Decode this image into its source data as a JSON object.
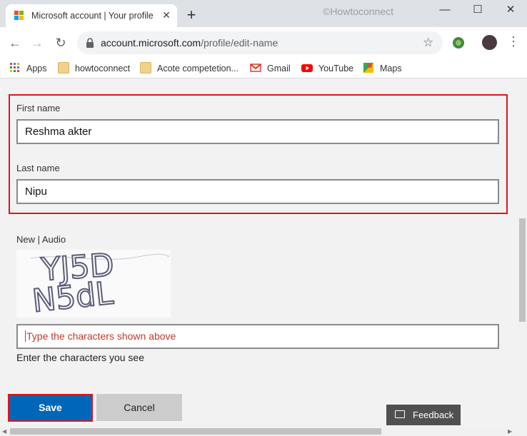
{
  "browser": {
    "tab_title": "Microsoft account | Your profile |",
    "tab_close": "✕",
    "new_tab": "+",
    "watermark": "©Howtoconnect",
    "minimize": "—",
    "maximize": "☐",
    "close": "✕",
    "back_icon": "←",
    "forward_icon": "→",
    "reload_icon": "↻",
    "url_host": "account.microsoft.com",
    "url_path": "/profile/edit-name",
    "star_icon": "☆",
    "menu_icon": "⋮"
  },
  "bookmarks": [
    {
      "label": "Apps",
      "icon": "apps-grid-icon"
    },
    {
      "label": "howtoconnect",
      "icon": "folder-icon"
    },
    {
      "label": "Acote competetion...",
      "icon": "folder-icon"
    },
    {
      "label": "Gmail",
      "icon": "gmail-icon"
    },
    {
      "label": "YouTube",
      "icon": "youtube-icon"
    },
    {
      "label": "Maps",
      "icon": "maps-icon"
    }
  ],
  "form": {
    "first_name_label": "First name",
    "first_name_value": "Reshma akter",
    "last_name_label": "Last name",
    "last_name_value": "Nipu",
    "captcha_switch": "New | Audio",
    "captcha_text": "YJ5D N5dL",
    "captcha_placeholder": "Type the characters shown above",
    "captcha_hint": "Enter the characters you see",
    "save_label": "Save",
    "cancel_label": "Cancel",
    "feedback_label": "Feedback"
  },
  "colors": {
    "highlight": "#e1141c",
    "primary_button": "#0067b8",
    "placeholder_text": "#c0392b"
  }
}
